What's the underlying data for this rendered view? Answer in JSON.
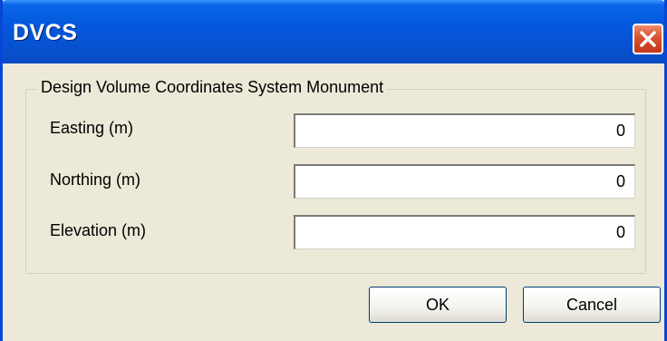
{
  "window": {
    "title": "DVCS"
  },
  "group": {
    "title": "Design Volume Coordinates System Monument"
  },
  "fields": [
    {
      "label": "Easting (m)",
      "value": "0"
    },
    {
      "label": "Northing (m)",
      "value": "0"
    },
    {
      "label": "Elevation (m)",
      "value": "0"
    }
  ],
  "buttons": {
    "ok": "OK",
    "cancel": "Cancel"
  },
  "icons": {
    "close": "close-icon"
  },
  "colors": {
    "titlebar": "#0458dc",
    "close": "#d9522c",
    "dialog_bg": "#ece9d8"
  }
}
